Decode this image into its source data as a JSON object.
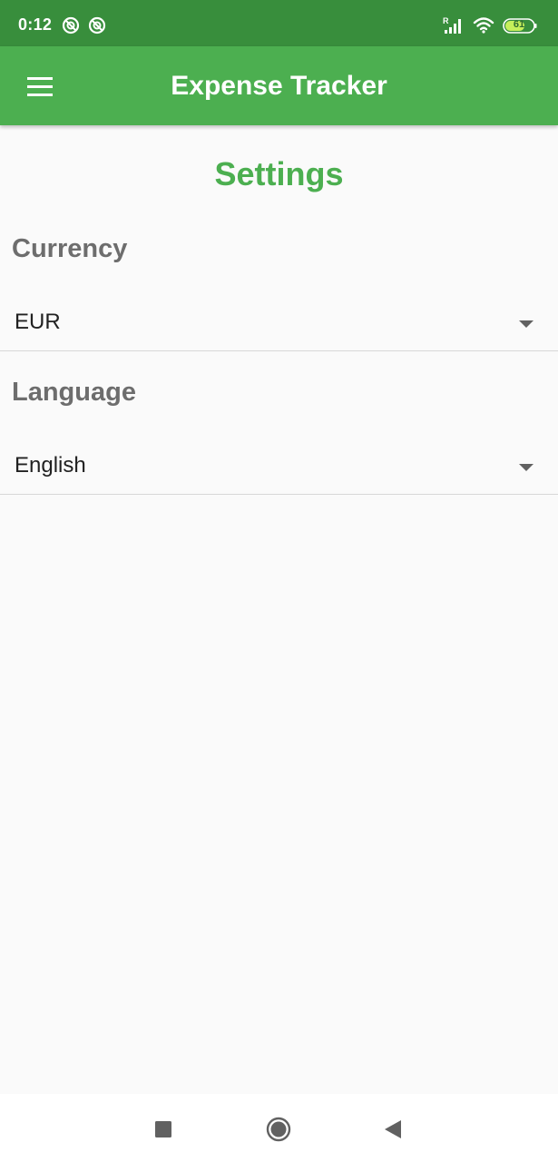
{
  "status_bar": {
    "time": "0:12",
    "battery_level": "61",
    "icons": [
      "do-not-disturb-icon",
      "do-not-disturb-icon",
      "signal-roaming-icon",
      "wifi-icon",
      "battery-icon"
    ]
  },
  "app_bar": {
    "title": "Expense Tracker",
    "menu_icon": "hamburger-menu-icon"
  },
  "page": {
    "title": "Settings"
  },
  "settings": {
    "currency": {
      "label": "Currency",
      "value": "EUR"
    },
    "language": {
      "label": "Language",
      "value": "English"
    }
  },
  "nav_bar": {
    "icons": [
      "recents-icon",
      "home-icon",
      "back-icon"
    ]
  },
  "colors": {
    "status_bar": "#388e3c",
    "app_bar": "#4caf50",
    "accent": "#4caf50",
    "background": "#fafafa",
    "section_label": "#6d6d6d"
  }
}
